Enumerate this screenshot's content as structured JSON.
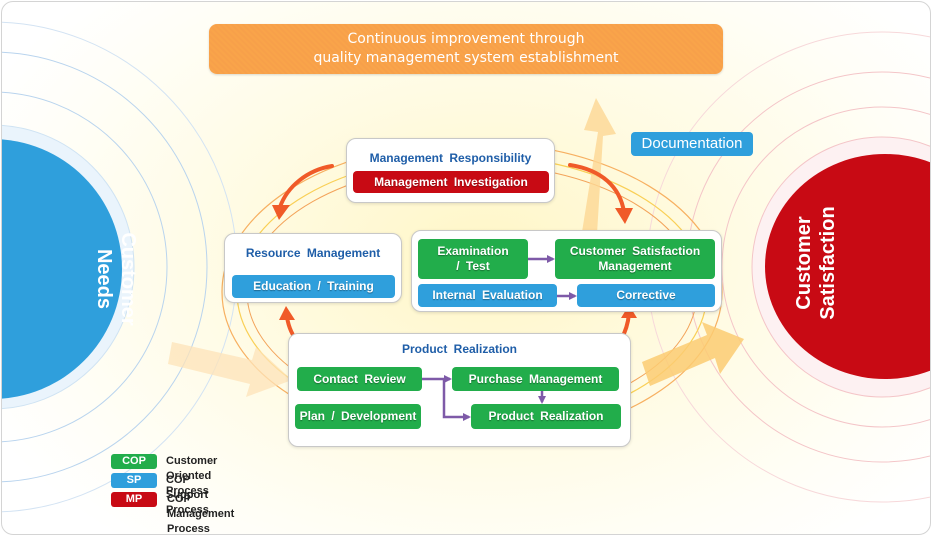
{
  "banner": {
    "line1": "Continuous improvement through",
    "line2": "quality management system establishment"
  },
  "documentation_label": "Documentation",
  "circles": {
    "left": {
      "line1": "Customer",
      "line2": "Needs",
      "color": "#2f9fdc"
    },
    "right": {
      "line1": "Customer",
      "line2": "Satisfaction",
      "color": "#c80a14"
    }
  },
  "management_responsibility": {
    "title": "Management  Responsibility",
    "items": [
      {
        "label": "Management  Investigation",
        "type": "MP"
      }
    ]
  },
  "resource_management": {
    "title": "Resource  Management",
    "items": [
      {
        "label": "Education  / Training",
        "type": "SP"
      }
    ]
  },
  "measurement": {
    "items": [
      {
        "label": "Examination / Test",
        "line1": "Examination",
        "line2": "/ Test",
        "type": "COP"
      },
      {
        "label": "Customer Satisfaction Management",
        "line1": "Customer  Satisfaction",
        "line2": "Management",
        "type": "COP"
      },
      {
        "label": "Internal  Evaluation",
        "type": "SP"
      },
      {
        "label": "Corrective",
        "type": "SP"
      }
    ]
  },
  "product_realization": {
    "title": "Product  Realization",
    "items": [
      {
        "label": "Contact  Review",
        "type": "COP"
      },
      {
        "label": "Purchase  Management",
        "type": "COP"
      },
      {
        "label": "Plan / Development",
        "type": "COP"
      },
      {
        "label": "Product  Realization",
        "type": "COP"
      }
    ]
  },
  "legend": [
    {
      "code": "COP",
      "label": "Customer Oriented Process",
      "color": "#22ad4b"
    },
    {
      "code": "SP",
      "label": "COP Support Process",
      "color": "#2f9fdc"
    },
    {
      "code": "MP",
      "label": "COP Management Process",
      "color": "#c80a14"
    }
  ],
  "colors": {
    "cop": "#22ad4b",
    "sp": "#2f9fdc",
    "mp": "#c80a14",
    "title_blue": "#1f5ea8",
    "banner_orange": "#f9a44a",
    "cycle_arrow": "#f05a28",
    "flow_arrow": "#7e5aa8"
  }
}
